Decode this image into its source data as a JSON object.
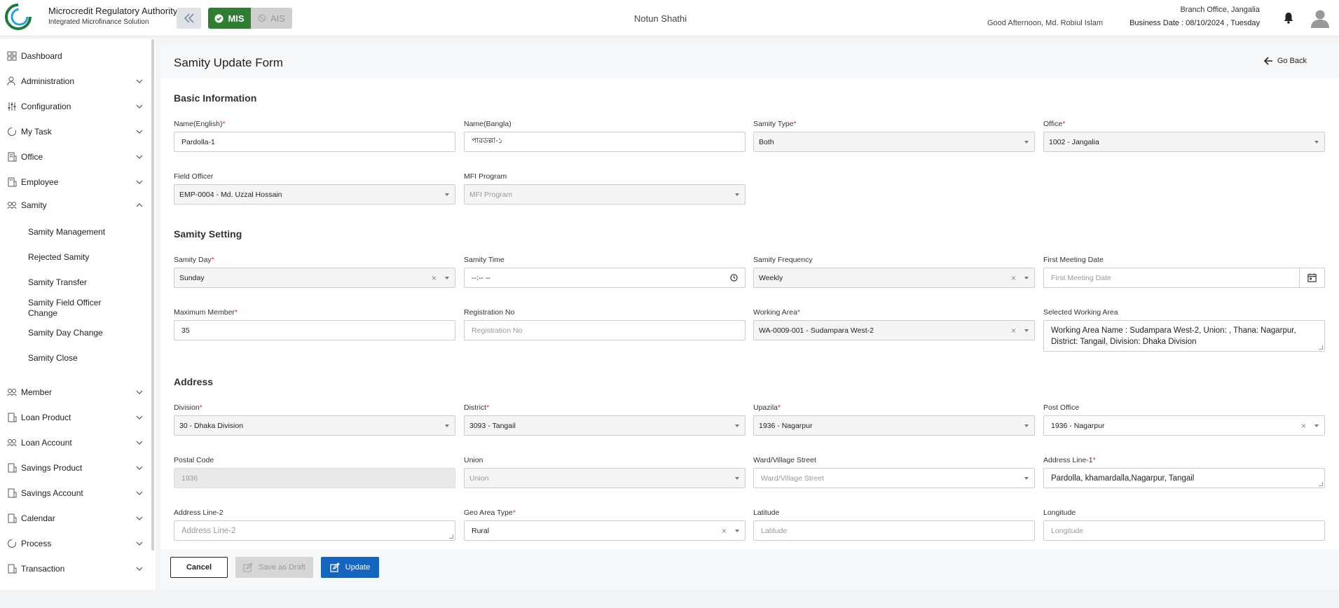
{
  "header": {
    "brand_title": "Microcredit Regulatory Authority",
    "brand_sub": "Integrated Microfinance Solution",
    "logo_text": "Microcredit Regulatory Authority",
    "mis_label": "MIS",
    "ais_label": "AIS",
    "org_name": "Notun Shathi",
    "greeting": "Good Afternoon, Md. Robiul Islam",
    "branch": "Branch Office, Jangalia",
    "business_date": "Business Date : 08/10/2024 , Tuesday"
  },
  "sidebar": {
    "items": [
      {
        "label": "Dashboard"
      },
      {
        "label": "Administration"
      },
      {
        "label": "Configuration"
      },
      {
        "label": "My Task"
      },
      {
        "label": "Office"
      },
      {
        "label": "Employee"
      },
      {
        "label": "Samity"
      },
      {
        "label": "Member"
      },
      {
        "label": "Loan Product"
      },
      {
        "label": "Loan Account"
      },
      {
        "label": "Savings Product"
      },
      {
        "label": "Savings Account"
      },
      {
        "label": "Calendar"
      },
      {
        "label": "Process"
      },
      {
        "label": "Transaction"
      }
    ],
    "samity_sub": [
      {
        "label": "Samity Management"
      },
      {
        "label": "Rejected Samity"
      },
      {
        "label": "Samity Transfer"
      },
      {
        "label": "Samity Field Officer Change"
      },
      {
        "label": "Samity Day Change"
      },
      {
        "label": "Samity Close"
      }
    ]
  },
  "page": {
    "title": "Samity Update Form",
    "go_back": "Go Back"
  },
  "sections": {
    "basic": "Basic Information",
    "setting": "Samity Setting",
    "address": "Address"
  },
  "fields": {
    "name_en": {
      "label": "Name(English)",
      "value": "Pardolla-1"
    },
    "name_bn": {
      "label": "Name(Bangla)",
      "value": "পারডল্লা-১"
    },
    "samity_type": {
      "label": "Samity Type",
      "value": "Both"
    },
    "office": {
      "label": "Office",
      "value": "1002 - Jangalia"
    },
    "field_officer": {
      "label": "Field Officer",
      "value": "EMP-0004 - Md. Uzzal Hossain"
    },
    "mfi_program": {
      "label": "MFI Program",
      "placeholder": "MFI Program"
    },
    "samity_day": {
      "label": "Samity Day",
      "value": "Sunday"
    },
    "samity_time": {
      "label": "Samity Time",
      "value": "--:-- --"
    },
    "samity_frequency": {
      "label": "Samity Frequency",
      "value": "Weekly"
    },
    "first_meeting": {
      "label": "First Meeting Date",
      "placeholder": "First Meeting Date"
    },
    "max_member": {
      "label": "Maximum Member",
      "value": "35"
    },
    "registration_no": {
      "label": "Registration No",
      "placeholder": "Registration No"
    },
    "working_area": {
      "label": "Working Area",
      "value": "WA-0009-001 - Sudampara West-2"
    },
    "selected_area": {
      "label": "Selected Working Area",
      "value": "Working Area Name : Sudampara West-2, Union: , Thana:  Nagarpur, District: Tangail, Division: Dhaka Division"
    },
    "division": {
      "label": "Division",
      "value": "30 - Dhaka Division"
    },
    "district": {
      "label": "District",
      "value": "3093 - Tangail"
    },
    "upazila": {
      "label": "Upazila",
      "value": "1936 - Nagarpur"
    },
    "post_office": {
      "label": "Post Office",
      "value": "1936 - Nagarpur"
    },
    "postal_code": {
      "label": "Postal Code",
      "value": "1936"
    },
    "union": {
      "label": "Union",
      "placeholder": "Union"
    },
    "ward": {
      "label": "Ward/Village Street",
      "placeholder": "Ward/Village Street"
    },
    "address1": {
      "label": "Address Line-1",
      "value": "Pardolla, khamardalla,Nagarpur, Tangail"
    },
    "address2": {
      "label": "Address Line-2",
      "placeholder": "Address Line-2"
    },
    "geo_area": {
      "label": "Geo Area Type",
      "value": "Rural"
    },
    "latitude": {
      "label": "Latitude",
      "placeholder": "Latitude"
    },
    "longitude": {
      "label": "Longitude",
      "placeholder": "Longitude"
    }
  },
  "footer": {
    "cancel": "Cancel",
    "draft": "Save as Draft",
    "update": "Update"
  },
  "colors": {
    "mis_green": "#2e7d32",
    "update_blue": "#1565c0",
    "required_red": "#d32f2f"
  }
}
